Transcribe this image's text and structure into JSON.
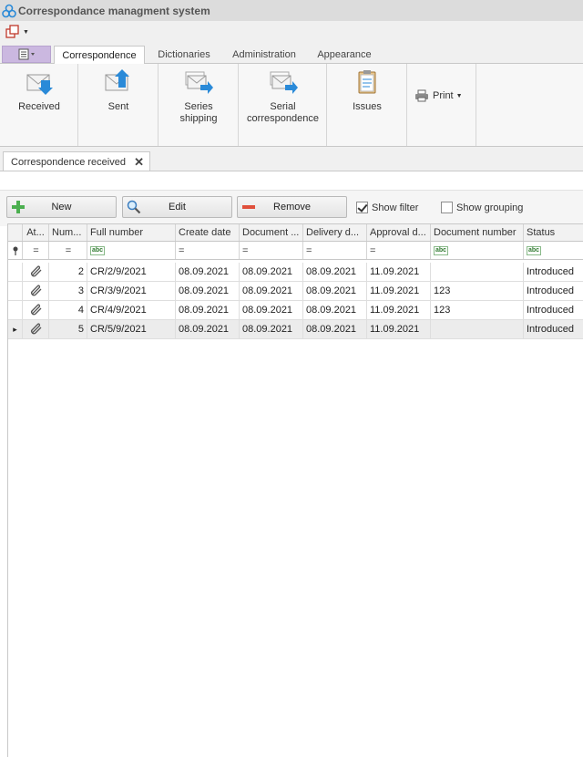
{
  "window": {
    "title": "Correspondance managment system"
  },
  "ribbon_tabs": [
    {
      "label": "Correspondence",
      "active": true
    },
    {
      "label": "Dictionaries",
      "active": false
    },
    {
      "label": "Administration",
      "active": false
    },
    {
      "label": "Appearance",
      "active": false
    }
  ],
  "ribbon_buttons": {
    "received": "Received",
    "sent": "Sent",
    "series_shipping": "Series\nshipping",
    "serial_correspondence": "Serial\ncorrespondence",
    "issues": "Issues",
    "print": "Print"
  },
  "document_tab": {
    "label": "Correspondence received"
  },
  "toolbar": {
    "new_label": "New",
    "edit_label": "Edit",
    "remove_label": "Remove",
    "show_filter_label": "Show filter",
    "show_filter_checked": true,
    "show_grouping_label": "Show grouping",
    "show_grouping_checked": false
  },
  "grid": {
    "columns": [
      "At...",
      "Num...",
      "Full number",
      "Create date",
      "Document ...",
      "Delivery d...",
      "Approval d...",
      "Document number",
      "Status"
    ],
    "filter_row": [
      "",
      "=",
      "=",
      "abc",
      "=",
      "=",
      "=",
      "=",
      "abc",
      "abc"
    ],
    "rows": [
      {
        "attach": true,
        "num": "2",
        "full_number": "CR/2/9/2021",
        "create_date": "08.09.2021",
        "document_date": "08.09.2021",
        "delivery_date": "08.09.2021",
        "approval_date": "11.09.2021",
        "document_number": "",
        "status": "Introduced",
        "selected": false
      },
      {
        "attach": true,
        "num": "3",
        "full_number": "CR/3/9/2021",
        "create_date": "08.09.2021",
        "document_date": "08.09.2021",
        "delivery_date": "08.09.2021",
        "approval_date": "11.09.2021",
        "document_number": "123",
        "status": "Introduced",
        "selected": false
      },
      {
        "attach": true,
        "num": "4",
        "full_number": "CR/4/9/2021",
        "create_date": "08.09.2021",
        "document_date": "08.09.2021",
        "delivery_date": "08.09.2021",
        "approval_date": "11.09.2021",
        "document_number": "123",
        "status": "Introduced",
        "selected": false
      },
      {
        "attach": true,
        "num": "5",
        "full_number": "CR/5/9/2021",
        "create_date": "08.09.2021",
        "document_date": "08.09.2021",
        "delivery_date": "08.09.2021",
        "approval_date": "11.09.2021",
        "document_number": "",
        "status": "Introduced",
        "selected": true
      }
    ]
  },
  "colors": {
    "app_menu": "#cbb8e0",
    "accent_blue": "#2a8ad8",
    "ribbon_bg": "#f7f7f7"
  }
}
